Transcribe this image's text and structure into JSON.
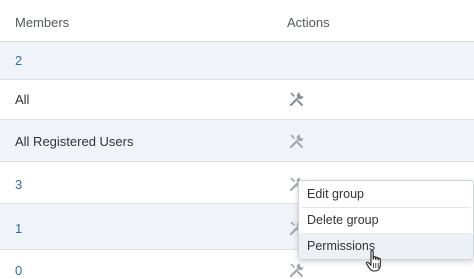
{
  "table": {
    "columns": [
      "Members",
      "Actions"
    ],
    "rows": [
      {
        "member": "2",
        "is_link": true,
        "has_actions": false
      },
      {
        "member": "All",
        "is_link": false,
        "has_actions": true
      },
      {
        "member": "All Registered Users",
        "is_link": false,
        "has_actions": true
      },
      {
        "member": "3",
        "is_link": true,
        "has_actions": true
      },
      {
        "member": "1",
        "is_link": true,
        "has_actions": true
      },
      {
        "member": "0",
        "is_link": true,
        "has_actions": true
      }
    ]
  },
  "actions_menu": {
    "items": [
      "Edit group",
      "Delete group",
      "Permissions"
    ],
    "hovered_item": "Permissions"
  },
  "icons": {
    "action": "wrench-icon",
    "pointer": "hand-pointer-icon"
  },
  "colors": {
    "link": "#2a6fb3",
    "row_alt": "#f0f3f8",
    "text": "#333333"
  }
}
